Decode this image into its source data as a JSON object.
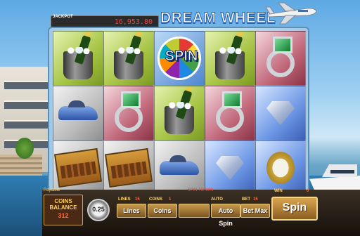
{
  "header": {
    "jackpot_label": "JACKPOT",
    "jackpot_value": "16,953.80",
    "game_title": "DREAM WHEEL"
  },
  "reels": {
    "rows": [
      [
        {
          "symbol": "champagne-bucket",
          "bg": "green"
        },
        {
          "symbol": "champagne-bucket",
          "bg": "green"
        },
        {
          "symbol": "spin-wheel",
          "bg": "spin",
          "label": "SPIN"
        },
        {
          "symbol": "champagne-bucket",
          "bg": "green"
        },
        {
          "symbol": "emerald-ring",
          "bg": "red"
        }
      ],
      [
        {
          "symbol": "sports-car",
          "bg": "gray"
        },
        {
          "symbol": "emerald-ring",
          "bg": "red"
        },
        {
          "symbol": "champagne-bucket",
          "bg": "green"
        },
        {
          "symbol": "emerald-ring",
          "bg": "red"
        },
        {
          "symbol": "diamond",
          "bg": "blue"
        }
      ],
      [
        {
          "symbol": "cigar-box",
          "bg": "gray"
        },
        {
          "symbol": "cigar-box",
          "bg": "gray"
        },
        {
          "symbol": "sports-car",
          "bg": "gray"
        },
        {
          "symbol": "diamond",
          "bg": "blue"
        },
        {
          "symbol": "gold-watch",
          "bg": "blue"
        }
      ]
    ]
  },
  "controls": {
    "paytable_label": "Paytable",
    "coins_balance_line1": "COINS",
    "coins_balance_line2": "BALANCE",
    "coins_balance_value": "312",
    "coin_value": "0.25",
    "spin_to_win": "SPIN TO WIN",
    "lines_label": "LINES",
    "lines_value": "15",
    "coins_label": "COINS",
    "coins_value": "1",
    "auto_label": "AUTO",
    "bet_label": "BET",
    "bet_value": "15",
    "win_label": "WIN",
    "win_value": "0",
    "lines_button": "Lines",
    "coins_button": "Coins",
    "autospin_button": "Auto Spin",
    "betmax_button": "Bet Max",
    "spin_button": "Spin"
  }
}
